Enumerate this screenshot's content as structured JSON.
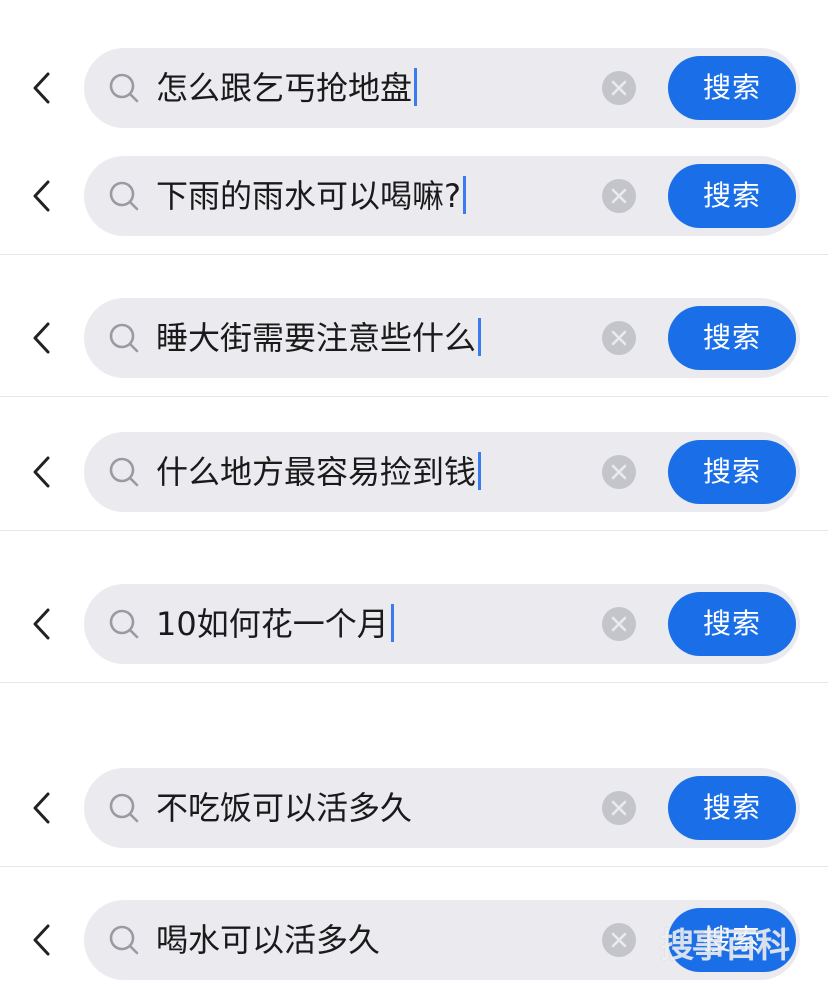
{
  "search_button_label": "搜索",
  "accent_color": "#1a6fe8",
  "rows": [
    {
      "query": "怎么跟乞丐抢地盘",
      "caret": true
    },
    {
      "query": "下雨的雨水可以喝嘛?",
      "caret": true
    },
    {
      "query": "睡大街需要注意些什么",
      "caret": true
    },
    {
      "query": "什么地方最容易捡到钱",
      "caret": true
    },
    {
      "query": "10如何花一个月",
      "caret": true
    },
    {
      "query": "不吃饭可以活多久",
      "caret": false
    },
    {
      "query": "喝水可以活多久",
      "caret": false
    }
  ],
  "watermark": "搜事百科",
  "icons": {
    "back": "chevron-left-icon",
    "search": "search-icon",
    "clear": "clear-icon"
  }
}
